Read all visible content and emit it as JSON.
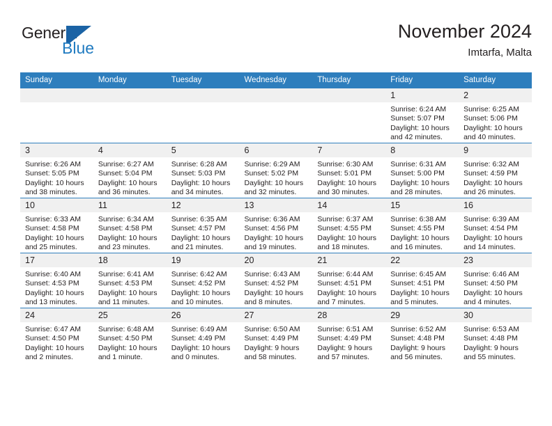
{
  "brand": {
    "name_part1": "General",
    "name_part2": "Blue",
    "logo_icon": "triangle-flag-icon",
    "accent_color": "#1b63a5",
    "blue_text_color": "#1f7ac0"
  },
  "header": {
    "title": "November 2024",
    "location": "Imtarfa, Malta"
  },
  "theme": {
    "header_row_background": "#2e7ebd",
    "day_number_background": "#f0f0f0",
    "cell_background": "#ffffff",
    "text_color": "#231f20"
  },
  "weekday_headers": [
    "Sunday",
    "Monday",
    "Tuesday",
    "Wednesday",
    "Thursday",
    "Friday",
    "Saturday"
  ],
  "weeks": [
    [
      {
        "day": "",
        "sunrise": "",
        "sunset": "",
        "daylight_line1": "",
        "daylight_line2": ""
      },
      {
        "day": "",
        "sunrise": "",
        "sunset": "",
        "daylight_line1": "",
        "daylight_line2": ""
      },
      {
        "day": "",
        "sunrise": "",
        "sunset": "",
        "daylight_line1": "",
        "daylight_line2": ""
      },
      {
        "day": "",
        "sunrise": "",
        "sunset": "",
        "daylight_line1": "",
        "daylight_line2": ""
      },
      {
        "day": "",
        "sunrise": "",
        "sunset": "",
        "daylight_line1": "",
        "daylight_line2": ""
      },
      {
        "day": "1",
        "sunrise": "Sunrise: 6:24 AM",
        "sunset": "Sunset: 5:07 PM",
        "daylight_line1": "Daylight: 10 hours",
        "daylight_line2": "and 42 minutes."
      },
      {
        "day": "2",
        "sunrise": "Sunrise: 6:25 AM",
        "sunset": "Sunset: 5:06 PM",
        "daylight_line1": "Daylight: 10 hours",
        "daylight_line2": "and 40 minutes."
      }
    ],
    [
      {
        "day": "3",
        "sunrise": "Sunrise: 6:26 AM",
        "sunset": "Sunset: 5:05 PM",
        "daylight_line1": "Daylight: 10 hours",
        "daylight_line2": "and 38 minutes."
      },
      {
        "day": "4",
        "sunrise": "Sunrise: 6:27 AM",
        "sunset": "Sunset: 5:04 PM",
        "daylight_line1": "Daylight: 10 hours",
        "daylight_line2": "and 36 minutes."
      },
      {
        "day": "5",
        "sunrise": "Sunrise: 6:28 AM",
        "sunset": "Sunset: 5:03 PM",
        "daylight_line1": "Daylight: 10 hours",
        "daylight_line2": "and 34 minutes."
      },
      {
        "day": "6",
        "sunrise": "Sunrise: 6:29 AM",
        "sunset": "Sunset: 5:02 PM",
        "daylight_line1": "Daylight: 10 hours",
        "daylight_line2": "and 32 minutes."
      },
      {
        "day": "7",
        "sunrise": "Sunrise: 6:30 AM",
        "sunset": "Sunset: 5:01 PM",
        "daylight_line1": "Daylight: 10 hours",
        "daylight_line2": "and 30 minutes."
      },
      {
        "day": "8",
        "sunrise": "Sunrise: 6:31 AM",
        "sunset": "Sunset: 5:00 PM",
        "daylight_line1": "Daylight: 10 hours",
        "daylight_line2": "and 28 minutes."
      },
      {
        "day": "9",
        "sunrise": "Sunrise: 6:32 AM",
        "sunset": "Sunset: 4:59 PM",
        "daylight_line1": "Daylight: 10 hours",
        "daylight_line2": "and 26 minutes."
      }
    ],
    [
      {
        "day": "10",
        "sunrise": "Sunrise: 6:33 AM",
        "sunset": "Sunset: 4:58 PM",
        "daylight_line1": "Daylight: 10 hours",
        "daylight_line2": "and 25 minutes."
      },
      {
        "day": "11",
        "sunrise": "Sunrise: 6:34 AM",
        "sunset": "Sunset: 4:58 PM",
        "daylight_line1": "Daylight: 10 hours",
        "daylight_line2": "and 23 minutes."
      },
      {
        "day": "12",
        "sunrise": "Sunrise: 6:35 AM",
        "sunset": "Sunset: 4:57 PM",
        "daylight_line1": "Daylight: 10 hours",
        "daylight_line2": "and 21 minutes."
      },
      {
        "day": "13",
        "sunrise": "Sunrise: 6:36 AM",
        "sunset": "Sunset: 4:56 PM",
        "daylight_line1": "Daylight: 10 hours",
        "daylight_line2": "and 19 minutes."
      },
      {
        "day": "14",
        "sunrise": "Sunrise: 6:37 AM",
        "sunset": "Sunset: 4:55 PM",
        "daylight_line1": "Daylight: 10 hours",
        "daylight_line2": "and 18 minutes."
      },
      {
        "day": "15",
        "sunrise": "Sunrise: 6:38 AM",
        "sunset": "Sunset: 4:55 PM",
        "daylight_line1": "Daylight: 10 hours",
        "daylight_line2": "and 16 minutes."
      },
      {
        "day": "16",
        "sunrise": "Sunrise: 6:39 AM",
        "sunset": "Sunset: 4:54 PM",
        "daylight_line1": "Daylight: 10 hours",
        "daylight_line2": "and 14 minutes."
      }
    ],
    [
      {
        "day": "17",
        "sunrise": "Sunrise: 6:40 AM",
        "sunset": "Sunset: 4:53 PM",
        "daylight_line1": "Daylight: 10 hours",
        "daylight_line2": "and 13 minutes."
      },
      {
        "day": "18",
        "sunrise": "Sunrise: 6:41 AM",
        "sunset": "Sunset: 4:53 PM",
        "daylight_line1": "Daylight: 10 hours",
        "daylight_line2": "and 11 minutes."
      },
      {
        "day": "19",
        "sunrise": "Sunrise: 6:42 AM",
        "sunset": "Sunset: 4:52 PM",
        "daylight_line1": "Daylight: 10 hours",
        "daylight_line2": "and 10 minutes."
      },
      {
        "day": "20",
        "sunrise": "Sunrise: 6:43 AM",
        "sunset": "Sunset: 4:52 PM",
        "daylight_line1": "Daylight: 10 hours",
        "daylight_line2": "and 8 minutes."
      },
      {
        "day": "21",
        "sunrise": "Sunrise: 6:44 AM",
        "sunset": "Sunset: 4:51 PM",
        "daylight_line1": "Daylight: 10 hours",
        "daylight_line2": "and 7 minutes."
      },
      {
        "day": "22",
        "sunrise": "Sunrise: 6:45 AM",
        "sunset": "Sunset: 4:51 PM",
        "daylight_line1": "Daylight: 10 hours",
        "daylight_line2": "and 5 minutes."
      },
      {
        "day": "23",
        "sunrise": "Sunrise: 6:46 AM",
        "sunset": "Sunset: 4:50 PM",
        "daylight_line1": "Daylight: 10 hours",
        "daylight_line2": "and 4 minutes."
      }
    ],
    [
      {
        "day": "24",
        "sunrise": "Sunrise: 6:47 AM",
        "sunset": "Sunset: 4:50 PM",
        "daylight_line1": "Daylight: 10 hours",
        "daylight_line2": "and 2 minutes."
      },
      {
        "day": "25",
        "sunrise": "Sunrise: 6:48 AM",
        "sunset": "Sunset: 4:50 PM",
        "daylight_line1": "Daylight: 10 hours",
        "daylight_line2": "and 1 minute."
      },
      {
        "day": "26",
        "sunrise": "Sunrise: 6:49 AM",
        "sunset": "Sunset: 4:49 PM",
        "daylight_line1": "Daylight: 10 hours",
        "daylight_line2": "and 0 minutes."
      },
      {
        "day": "27",
        "sunrise": "Sunrise: 6:50 AM",
        "sunset": "Sunset: 4:49 PM",
        "daylight_line1": "Daylight: 9 hours",
        "daylight_line2": "and 58 minutes."
      },
      {
        "day": "28",
        "sunrise": "Sunrise: 6:51 AM",
        "sunset": "Sunset: 4:49 PM",
        "daylight_line1": "Daylight: 9 hours",
        "daylight_line2": "and 57 minutes."
      },
      {
        "day": "29",
        "sunrise": "Sunrise: 6:52 AM",
        "sunset": "Sunset: 4:48 PM",
        "daylight_line1": "Daylight: 9 hours",
        "daylight_line2": "and 56 minutes."
      },
      {
        "day": "30",
        "sunrise": "Sunrise: 6:53 AM",
        "sunset": "Sunset: 4:48 PM",
        "daylight_line1": "Daylight: 9 hours",
        "daylight_line2": "and 55 minutes."
      }
    ]
  ]
}
